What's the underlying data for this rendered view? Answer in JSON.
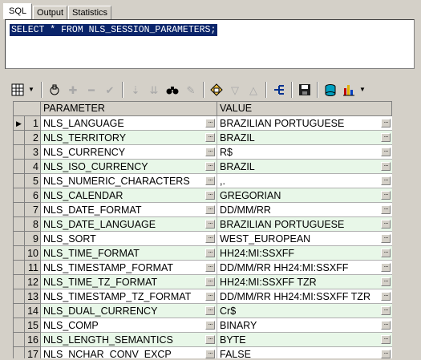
{
  "tabs": [
    {
      "label": "SQL",
      "active": true
    },
    {
      "label": "Output",
      "active": false
    },
    {
      "label": "Statistics",
      "active": false
    }
  ],
  "editor": {
    "query": "SELECT * FROM NLS_SESSION_PARAMETERS;"
  },
  "toolbar": {
    "icons": [
      "grid-icon",
      "dropdown-icon",
      "lock-icon",
      "plus-icon",
      "minus-icon",
      "check-icon",
      "arrow-down-icon",
      "arrow-down-double-icon",
      "binoculars-icon",
      "clear-icon",
      "table-icon",
      "triangle-down-icon",
      "triangle-up-icon",
      "query-icon",
      "save-icon",
      "database-icon",
      "chart-icon",
      "dropdown-icon"
    ]
  },
  "grid": {
    "columns": [
      "PARAMETER",
      "VALUE"
    ],
    "ellipsis": "···",
    "current_row_marker": "▶",
    "rows": [
      {
        "n": "1",
        "parameter": "NLS_LANGUAGE",
        "value": "BRAZILIAN PORTUGUESE"
      },
      {
        "n": "2",
        "parameter": "NLS_TERRITORY",
        "value": "BRAZIL"
      },
      {
        "n": "3",
        "parameter": "NLS_CURRENCY",
        "value": "R$"
      },
      {
        "n": "4",
        "parameter": "NLS_ISO_CURRENCY",
        "value": "BRAZIL"
      },
      {
        "n": "5",
        "parameter": "NLS_NUMERIC_CHARACTERS",
        "value": ",."
      },
      {
        "n": "6",
        "parameter": "NLS_CALENDAR",
        "value": "GREGORIAN"
      },
      {
        "n": "7",
        "parameter": "NLS_DATE_FORMAT",
        "value": "DD/MM/RR"
      },
      {
        "n": "8",
        "parameter": "NLS_DATE_LANGUAGE",
        "value": "BRAZILIAN PORTUGUESE"
      },
      {
        "n": "9",
        "parameter": "NLS_SORT",
        "value": "WEST_EUROPEAN"
      },
      {
        "n": "10",
        "parameter": "NLS_TIME_FORMAT",
        "value": "HH24:MI:SSXFF"
      },
      {
        "n": "11",
        "parameter": "NLS_TIMESTAMP_FORMAT",
        "value": "DD/MM/RR HH24:MI:SSXFF"
      },
      {
        "n": "12",
        "parameter": "NLS_TIME_TZ_FORMAT",
        "value": "HH24:MI:SSXFF TZR"
      },
      {
        "n": "13",
        "parameter": "NLS_TIMESTAMP_TZ_FORMAT",
        "value": "DD/MM/RR HH24:MI:SSXFF TZR"
      },
      {
        "n": "14",
        "parameter": "NLS_DUAL_CURRENCY",
        "value": "Cr$"
      },
      {
        "n": "15",
        "parameter": "NLS_COMP",
        "value": "BINARY"
      },
      {
        "n": "16",
        "parameter": "NLS_LENGTH_SEMANTICS",
        "value": "BYTE"
      },
      {
        "n": "17",
        "parameter": "NLS_NCHAR_CONV_EXCP",
        "value": "FALSE"
      }
    ]
  }
}
